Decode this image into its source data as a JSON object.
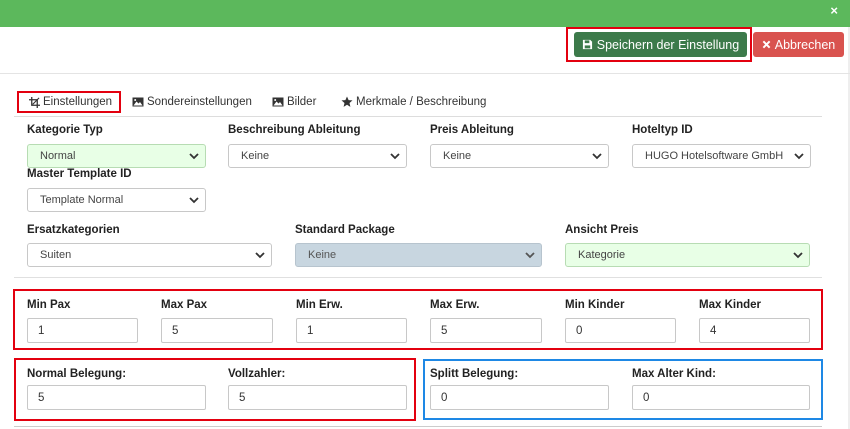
{
  "header": {
    "close_symbol": "×",
    "save_label": "Speichern der Einstellung",
    "cancel_label": "Abbrechen"
  },
  "tabs": [
    {
      "label": "Einstellungen",
      "icon": "crop-icon"
    },
    {
      "label": "Sondereinstellungen",
      "icon": "image-icon"
    },
    {
      "label": "Bilder",
      "icon": "image-icon"
    },
    {
      "label": "Merkmale / Beschreibung",
      "icon": "star-icon"
    }
  ],
  "fields": {
    "kategorie_typ": {
      "label": "Kategorie Typ",
      "value": "Normal"
    },
    "beschreibung_ableitung": {
      "label": "Beschreibung Ableitung",
      "value": "Keine"
    },
    "preis_ableitung": {
      "label": "Preis Ableitung",
      "value": "Keine"
    },
    "hoteltyp_id": {
      "label": "Hoteltyp ID",
      "value": "HUGO Hotelsoftware GmbH"
    },
    "master_template_id": {
      "label": "Master Template ID",
      "value": "Template Normal"
    },
    "ersatzkategorien": {
      "label": "Ersatzkategorien",
      "value": "Suiten"
    },
    "standard_package": {
      "label": "Standard Package",
      "value": "Keine"
    },
    "ansicht_preis": {
      "label": "Ansicht Preis",
      "value": "Kategorie"
    },
    "min_pax": {
      "label": "Min Pax",
      "value": "1"
    },
    "max_pax": {
      "label": "Max Pax",
      "value": "5"
    },
    "min_erw": {
      "label": "Min Erw.",
      "value": "1"
    },
    "max_erw": {
      "label": "Max Erw.",
      "value": "5"
    },
    "min_kinder": {
      "label": "Min Kinder",
      "value": "0"
    },
    "max_kinder": {
      "label": "Max Kinder",
      "value": "4"
    },
    "normal_belegung": {
      "label": "Normal Belegung:",
      "value": "5"
    },
    "vollzahler": {
      "label": "Vollzahler:",
      "value": "5"
    },
    "splitt_belegung": {
      "label": "Splitt Belegung:",
      "value": "0"
    },
    "max_alter_kind": {
      "label": "Max Alter Kind:",
      "value": "0"
    }
  },
  "colors": {
    "header_green": "#5cb85c",
    "save_green": "#3c7a4a",
    "cancel_red": "#d9534f",
    "highlight_red": "#e3000f",
    "highlight_blue": "#1e88e5",
    "select_green_bg": "#e8ffe6",
    "select_disabled_bg": "#c8d6e0"
  }
}
